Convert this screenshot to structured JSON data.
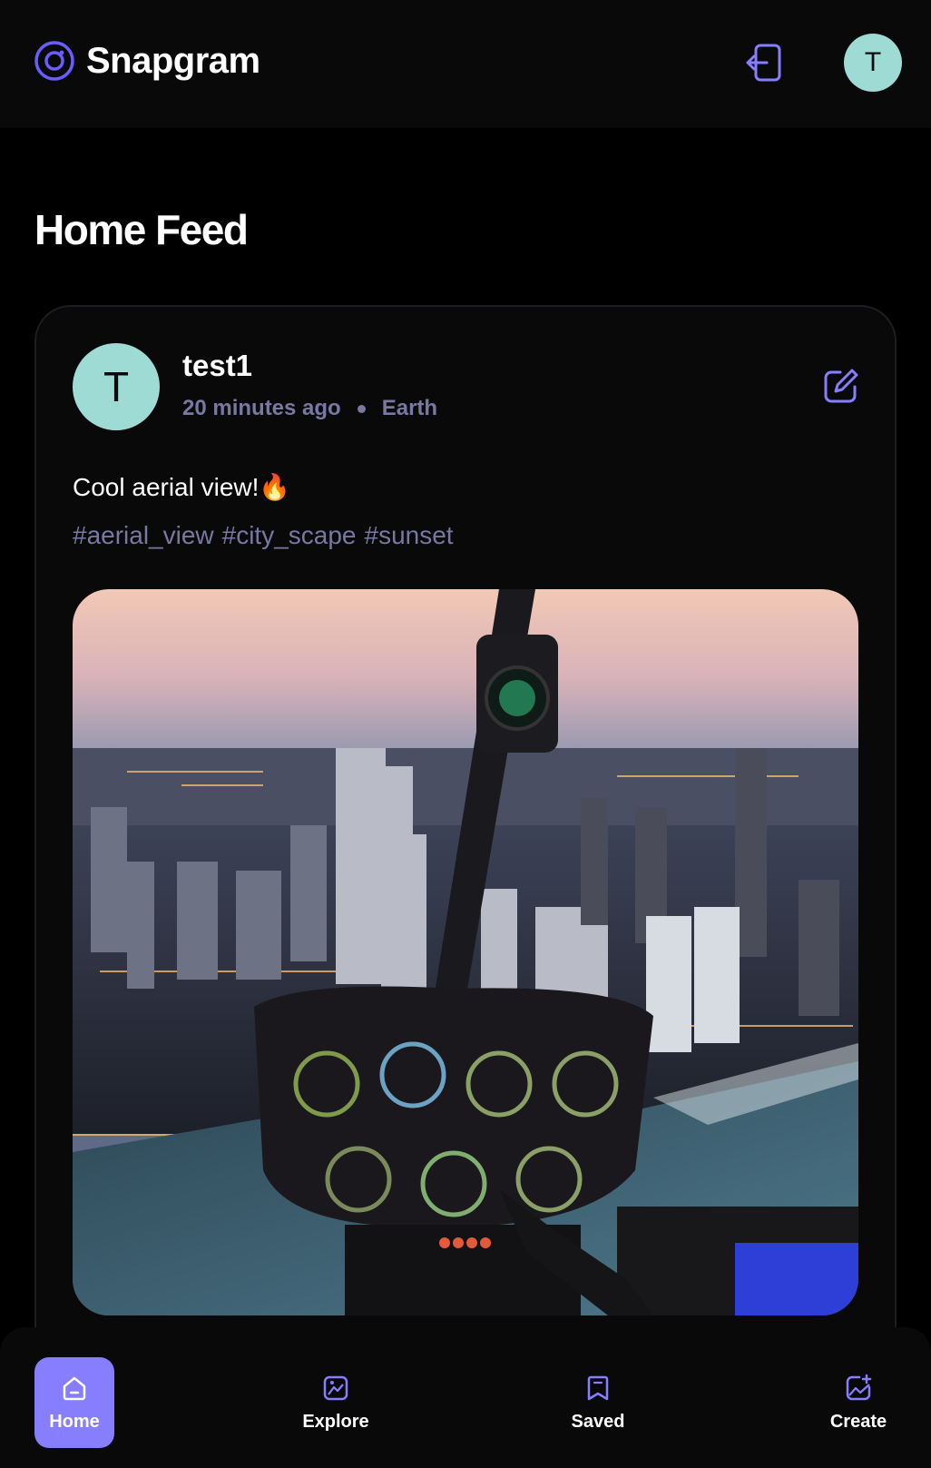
{
  "app": {
    "name": "Snapgram",
    "user_initial": "T"
  },
  "page": {
    "title": "Home Feed"
  },
  "post": {
    "author": "test1",
    "author_initial": "T",
    "time": "20 minutes ago",
    "location": "Earth",
    "caption": "Cool aerial view!🔥",
    "tags": [
      "#aerial_view",
      "#city_scape",
      "#sunset"
    ],
    "image_alt": "Aerial city view from helicopter cockpit at sunset"
  },
  "bottom_nav": {
    "items": [
      {
        "label": "Home",
        "icon": "home-icon",
        "active": true
      },
      {
        "label": "Explore",
        "icon": "explore-icon",
        "active": false
      },
      {
        "label": "Saved",
        "icon": "saved-icon",
        "active": false
      },
      {
        "label": "Create",
        "icon": "create-icon",
        "active": false
      }
    ]
  },
  "colors": {
    "accent": "#877eff",
    "muted": "#7878a3",
    "avatar": "#9fdbd5",
    "background": "#000000"
  }
}
